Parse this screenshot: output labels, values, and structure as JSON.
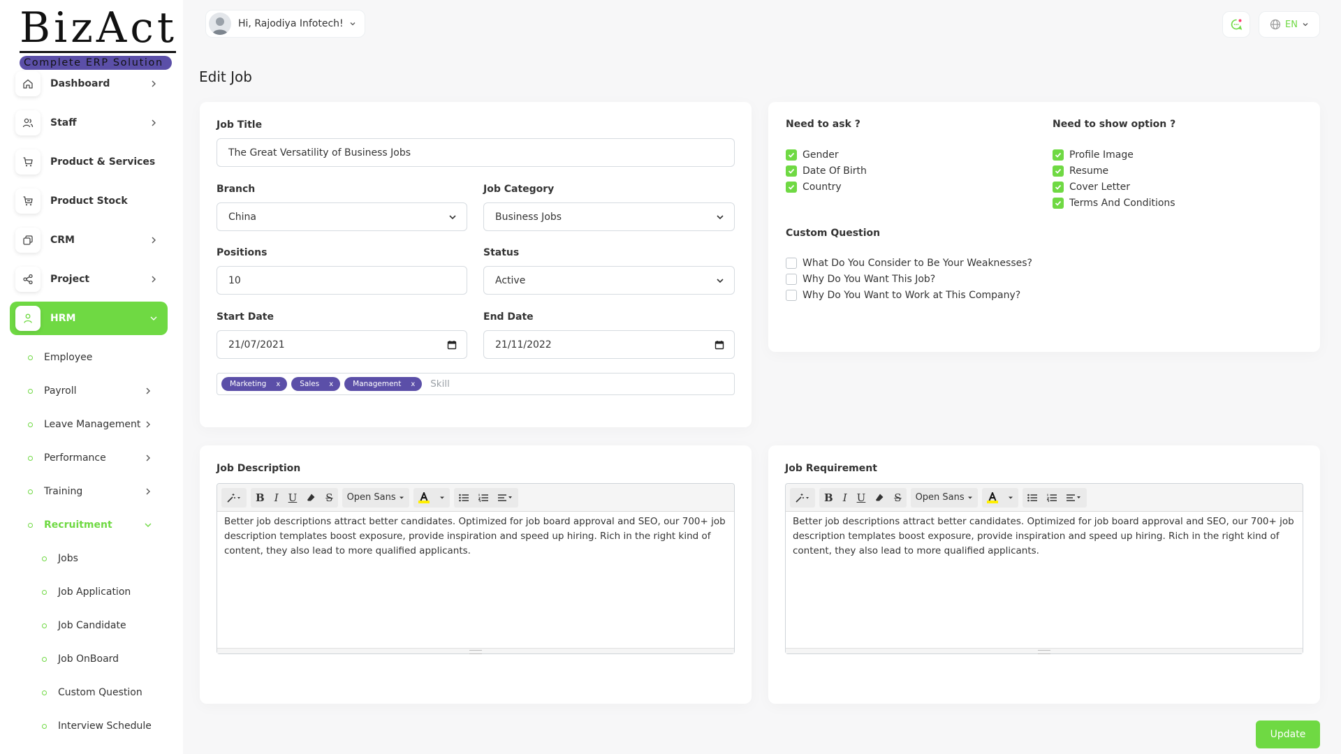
{
  "brand": {
    "name": "BizAct",
    "tagline": "Complete ERP Solution"
  },
  "header": {
    "greeting": "Hi, Rajodiya Infotech!",
    "language": "EN"
  },
  "page": {
    "title": "Edit Job"
  },
  "sidebar": {
    "items": [
      {
        "label": "Dashboard",
        "icon": "home-icon",
        "has_children": true
      },
      {
        "label": "Staff",
        "icon": "users-icon",
        "has_children": true
      },
      {
        "label": "Product & Services",
        "icon": "cart-icon",
        "has_children": false
      },
      {
        "label": "Product Stock",
        "icon": "cart-stock-icon",
        "has_children": false
      },
      {
        "label": "CRM",
        "icon": "layers-icon",
        "has_children": true
      },
      {
        "label": "Project",
        "icon": "share-icon",
        "has_children": true
      },
      {
        "label": "HRM",
        "icon": "user-icon",
        "has_children": true,
        "active": true
      }
    ],
    "hrm_sub": [
      {
        "label": "Employee"
      },
      {
        "label": "Payroll"
      },
      {
        "label": "Leave Management"
      },
      {
        "label": "Performance"
      },
      {
        "label": "Training"
      },
      {
        "label": "Recruitment"
      }
    ],
    "recruitment_sub": [
      {
        "label": "Jobs"
      },
      {
        "label": "Job Application"
      },
      {
        "label": "Job Candidate"
      },
      {
        "label": "Job OnBoard"
      },
      {
        "label": "Custom Question"
      },
      {
        "label": "Interview Schedule"
      }
    ]
  },
  "form": {
    "job_title": {
      "label": "Job Title",
      "value": "The Great Versatility of Business Jobs"
    },
    "branch": {
      "label": "Branch",
      "value": "China"
    },
    "job_category": {
      "label": "Job Category",
      "value": "Business Jobs"
    },
    "positions": {
      "label": "Positions",
      "value": "10"
    },
    "status": {
      "label": "Status",
      "value": "Active"
    },
    "start_date": {
      "label": "Start Date",
      "value": "21/07/2021"
    },
    "end_date": {
      "label": "End Date",
      "value": "21/11/2022"
    },
    "skills": {
      "tags": [
        "Marketing",
        "Sales",
        "Management"
      ],
      "remove": "x",
      "placeholder": "Skill"
    }
  },
  "options": {
    "need_to_ask": {
      "title": "Need to ask ?",
      "items": [
        "Gender",
        "Date Of Birth",
        "Country"
      ]
    },
    "need_to_show": {
      "title": "Need to show option ?",
      "items": [
        "Profile Image",
        "Resume",
        "Cover Letter",
        "Terms And Conditions"
      ]
    },
    "custom_question": {
      "title": "Custom Question",
      "items": [
        "What Do You Consider to Be Your Weaknesses?",
        "Why Do You Want This Job?",
        "Why Do You Want to Work at This Company?"
      ]
    }
  },
  "editors": {
    "font_name": "Open Sans",
    "description": {
      "label": "Job Description",
      "text": "Better job descriptions attract better candidates. Optimized for job board approval and SEO, our 700+ job description templates boost exposure, provide inspiration and speed up hiring. Rich in the right kind of content, they also lead to more qualified applicants."
    },
    "requirement": {
      "label": "Job Requirement",
      "text": "Better job descriptions attract better candidates. Optimized for job board approval and SEO, our 700+ job description templates boost exposure, provide inspiration and speed up hiring. Rich in the right kind of content, they also lead to more qualified applicants."
    }
  },
  "actions": {
    "update": "Update"
  },
  "colors": {
    "accent": "#6fd943",
    "tag": "#5b4fa8"
  }
}
